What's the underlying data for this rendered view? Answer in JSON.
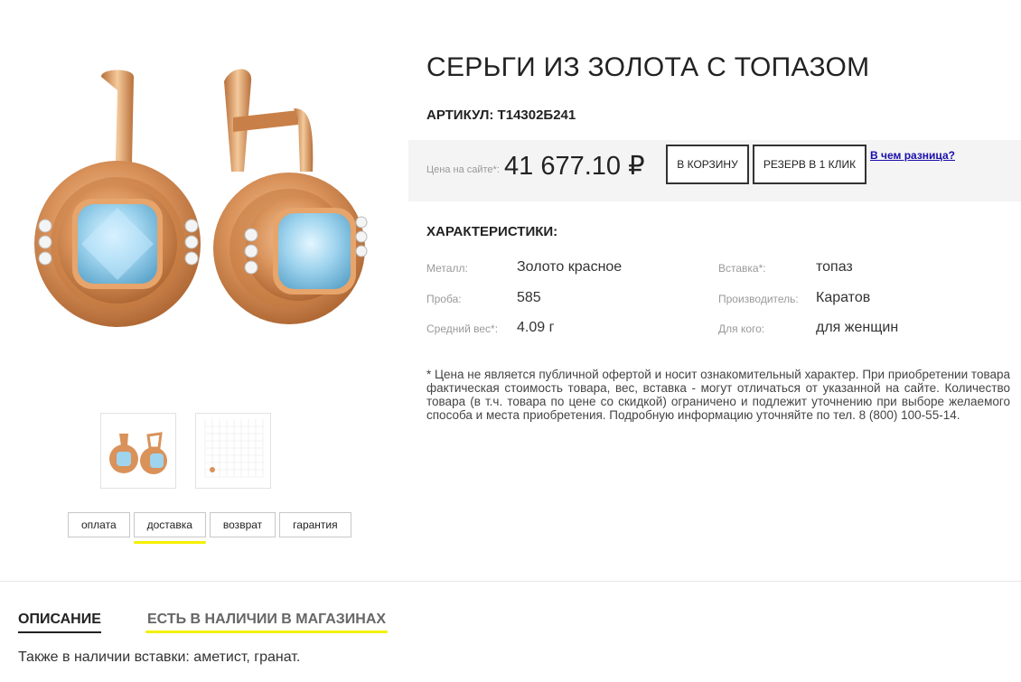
{
  "product": {
    "title": "СЕРЬГИ ИЗ ЗОЛОТА С ТОПАЗОМ",
    "article": "АРТИКУЛ: Т14302Б241",
    "price_label": "Цена на сайте*:",
    "price": "41 677.10 ₽",
    "cart_button": "В КОРЗИНУ",
    "reserve_button": "РЕЗЕРВ В 1 КЛИК",
    "difference_link": "В чем разница?"
  },
  "characteristics": {
    "heading": "ХАРАКТЕРИСТИКИ:",
    "left": [
      {
        "label": "Металл:",
        "value": "Золото красное"
      },
      {
        "label": "Проба:",
        "value": "585"
      },
      {
        "label": "Средний вес*:",
        "value": "4.09 г"
      }
    ],
    "right": [
      {
        "label": "Вставка*:",
        "value": "топаз"
      },
      {
        "label": "Производитель:",
        "value": "Каратов"
      },
      {
        "label": "Для кого:",
        "value": "для женщин"
      }
    ]
  },
  "disclaimer": "* Цена не является публичной офертой и носит ознакомительный характер. При приобретении товара фактическая стоимость товара, вес, вставка - могут отличаться от указанной на сайте. Количество товара (в т.ч. товара по цене со скидкой) ограничено и подлежит уточнению при выборе желаемого способа и места приобретения. Подробную информацию уточняйте по тел. 8 (800) 100-55-14.",
  "info_tabs": [
    "оплата",
    "доставка",
    "возврат",
    "гарантия"
  ],
  "active_info_tab": "доставка",
  "bottom_tabs": {
    "description": "ОПИСАНИЕ",
    "availability": "ЕСТЬ В НАЛИЧИИ В МАГАЗИНАХ"
  },
  "description_text": "Также в наличии вставки: аметист, гранат.",
  "colors": {
    "gold": "#d9925a",
    "topaz": "#9fd4ee",
    "highlight": "#f4f000",
    "link": "#1a0dab",
    "price_panel": "#f4f4f4"
  }
}
